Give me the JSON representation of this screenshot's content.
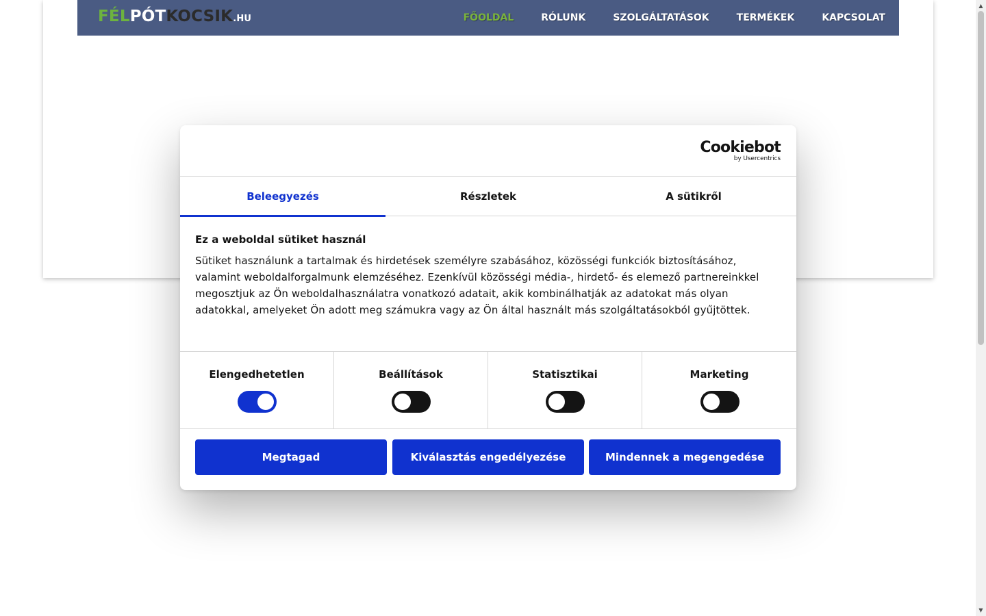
{
  "site": {
    "logo": {
      "part1": "FÉL",
      "part2": "PÓT",
      "part3": "KOCSIK",
      "part4": ".HU"
    },
    "nav": [
      {
        "label": "FŐOLDAL",
        "active": true
      },
      {
        "label": "RÓLUNK",
        "active": false
      },
      {
        "label": "SZOLGÁLTATÁSOK",
        "active": false
      },
      {
        "label": "TERMÉKEK",
        "active": false
      },
      {
        "label": "KAPCSOLAT",
        "active": false
      }
    ],
    "colors": {
      "navbar": "#4a5b83",
      "nav_active": "#7ab33c",
      "logo_green": "#6db33f"
    }
  },
  "cookie_dialog": {
    "logo": {
      "brand": "Cookiebot",
      "sub": "by Usercentrics"
    },
    "tabs": [
      {
        "label": "Beleegyezés",
        "active": true
      },
      {
        "label": "Részletek",
        "active": false
      },
      {
        "label": "A sütikről",
        "active": false
      }
    ],
    "title": "Ez a weboldal sütiket használ",
    "text": "Sütiket használunk a tartalmak és hirdetések személyre szabásához, közösségi funkciók biztosításához, valamint weboldalforgalmunk elemzéséhez. Ezenkívül közösségi média-, hirdető- és elemező partnereinkkel megosztjuk az Ön weboldalhasználatra vonatkozó adatait, akik kombinálhatják az adatokat más olyan adatokkal, amelyeket Ön adott meg számukra vagy az Ön által használt más szolgáltatásokból gyűjtöttek.",
    "toggles": [
      {
        "label": "Elengedhetetlen",
        "on": true
      },
      {
        "label": "Beállítások",
        "on": false
      },
      {
        "label": "Statisztikai",
        "on": false
      },
      {
        "label": "Marketing",
        "on": false
      }
    ],
    "buttons": {
      "deny": "Megtagad",
      "allow_selection": "Kiválasztás engedélyezése",
      "allow_all": "Mindennek a megengedése"
    },
    "colors": {
      "accent": "#1032cf",
      "toggle_off": "#141414"
    }
  }
}
